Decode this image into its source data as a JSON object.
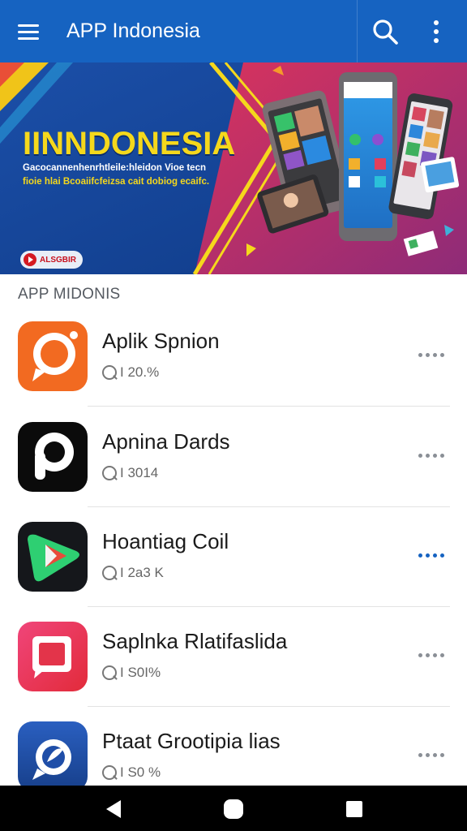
{
  "appbar": {
    "title": "APP Indonesia",
    "menu_icon": "hamburger-menu-icon",
    "search_icon": "search-icon",
    "more_icon": "more-vert-icon",
    "color": "#1663c1"
  },
  "banner": {
    "headline": "IINNDONESIA",
    "line1": "Gacocannenhenrhtleile:hleidon Vioe tecn",
    "line2": "fioie hlai Bcoaiifcfeizsa cait dobiog ecaifc.",
    "badge": "ALSGBIR"
  },
  "section": {
    "title": "APP MIDONIS"
  },
  "apps": [
    {
      "name": "Aplik Spnion",
      "meta": "I 20.%",
      "icon": "chat-bubble-orange-icon",
      "color": "#f26a21"
    },
    {
      "name": "Apnina Dards",
      "meta": "I 3014",
      "icon": "p-logo-icon",
      "color": "#0b0b0b"
    },
    {
      "name": "Hoantiag Coil",
      "meta": "I 2a3 K",
      "icon": "play-store-icon",
      "color": "#15171b"
    },
    {
      "name": "Saplnka Rlatifaslida",
      "meta": "I S0I%",
      "icon": "square-chat-red-icon",
      "color": "#e8334d"
    },
    {
      "name": "Ptaat Grootipia lias",
      "meta": "I S0 %",
      "icon": "chat-bubble-blue-icon",
      "color": "#1d4aa0"
    }
  ],
  "navbar": {
    "back_icon": "back-triangle-icon",
    "home_icon": "home-circle-icon",
    "recents_icon": "recents-square-icon"
  }
}
